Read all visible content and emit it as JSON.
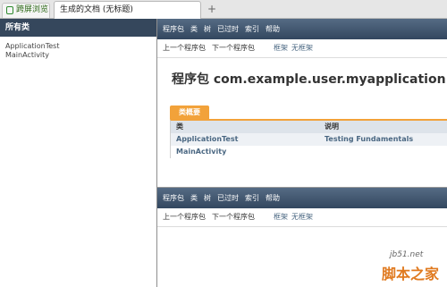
{
  "tabs": {
    "first_label": "跨屏浏览",
    "second_label": "生成的文档 (无标题)",
    "new_tab": "+"
  },
  "left": {
    "header": "所有类",
    "classes": [
      "ApplicationTest",
      "MainActivity"
    ]
  },
  "nav": {
    "items": [
      "程序包",
      "类",
      "树",
      "已过时",
      "索引",
      "帮助"
    ],
    "prev_pkg": "上一个程序包",
    "next_pkg": "下一个程序包",
    "frames": "框架",
    "no_frames": "无框架"
  },
  "main": {
    "title": "程序包 com.example.user.myapplication",
    "summary_tab": "类概要",
    "table": {
      "headers": [
        "类",
        "说明"
      ],
      "rows": [
        {
          "cls": "ApplicationTest",
          "desc": "Testing Fundamentals"
        },
        {
          "cls": "MainActivity",
          "desc": ""
        }
      ]
    }
  },
  "watermark": {
    "site": "jb51.net",
    "brand": "脚本之家"
  }
}
